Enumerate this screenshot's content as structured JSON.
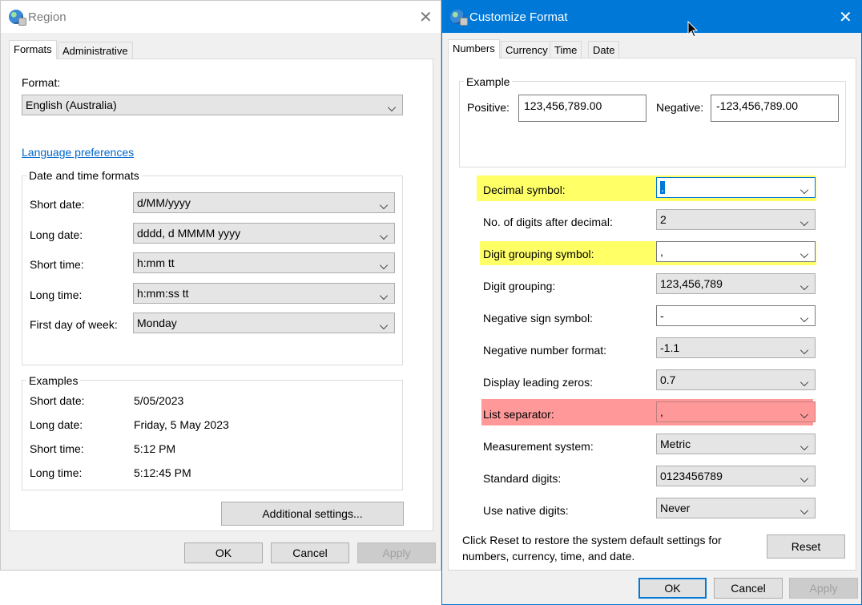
{
  "region": {
    "title": "Region",
    "tabs": [
      "Formats",
      "Administrative"
    ],
    "format_label": "Format:",
    "format_value": "English (Australia)",
    "language_link": "Language preferences",
    "dt_group_title": "Date and time formats",
    "dt_rows": [
      {
        "label": "Short date:",
        "value": "d/MM/yyyy"
      },
      {
        "label": "Long date:",
        "value": "dddd, d MMMM yyyy"
      },
      {
        "label": "Short time:",
        "value": "h:mm tt"
      },
      {
        "label": "Long time:",
        "value": "h:mm:ss tt"
      },
      {
        "label": "First day of week:",
        "value": "Monday"
      }
    ],
    "examples_title": "Examples",
    "examples": [
      {
        "label": "Short date:",
        "value": "5/05/2023"
      },
      {
        "label": "Long date:",
        "value": "Friday, 5 May 2023"
      },
      {
        "label": "Short time:",
        "value": "5:12 PM"
      },
      {
        "label": "Long time:",
        "value": "5:12:45 PM"
      }
    ],
    "additional_settings": "Additional settings...",
    "ok": "OK",
    "cancel": "Cancel",
    "apply": "Apply"
  },
  "customize": {
    "title": "Customize Format",
    "tabs": [
      "Numbers",
      "Currency",
      "Time",
      "Date"
    ],
    "example_title": "Example",
    "positive_label": "Positive:",
    "positive_value": "123,456,789.00",
    "negative_label": "Negative:",
    "negative_value": "-123,456,789.00",
    "rows": [
      {
        "label": "Decimal symbol:",
        "value": "."
      },
      {
        "label": "No. of digits after decimal:",
        "value": "2"
      },
      {
        "label": "Digit grouping symbol:",
        "value": ","
      },
      {
        "label": "Digit grouping:",
        "value": "123,456,789"
      },
      {
        "label": "Negative sign symbol:",
        "value": "-"
      },
      {
        "label": "Negative number format:",
        "value": "-1.1"
      },
      {
        "label": "Display leading zeros:",
        "value": "0.7"
      },
      {
        "label": "List separator:",
        "value": ","
      },
      {
        "label": "Measurement system:",
        "value": "Metric"
      },
      {
        "label": "Standard digits:",
        "value": "0123456789"
      },
      {
        "label": "Use native digits:",
        "value": "Never"
      }
    ],
    "reset_text_1": "Click Reset to restore the system default settings for",
    "reset_text_2": "numbers, currency, time, and date.",
    "reset": "Reset",
    "ok": "OK",
    "cancel": "Cancel",
    "apply": "Apply"
  },
  "colors": {
    "accent": "#0078d7",
    "highlight_yellow": "#ffff66",
    "highlight_red": "#ff9999",
    "link": "#0066cc"
  }
}
